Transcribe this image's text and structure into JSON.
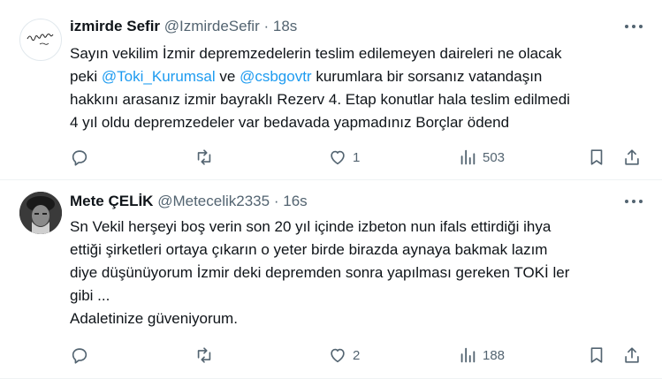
{
  "tweets": [
    {
      "name": "izmirde Sefir",
      "handle": "@IzmirdeSefir",
      "dot": "·",
      "time": "18s",
      "avatar_icon": "script-logo-avatar",
      "lines": [
        [
          {
            "t": "Sayın vekilim İzmir depremzedelerin teslim edilemeyen daireleri ne olacak"
          }
        ],
        [
          {
            "t": "peki "
          },
          {
            "t": "@Toki_Kurumsal",
            "m": true
          },
          {
            "t": " ve "
          },
          {
            "t": "@csbgovtr",
            "m": true
          },
          {
            "t": " kurumlara bir sorsanız vatandaşın"
          }
        ],
        [
          {
            "t": "hakkını arasanız izmir bayraklı Rezerv 4. Etap konutlar hala teslim edilmedi"
          }
        ],
        [
          {
            "t": "4 yıl oldu depremzedeler var bedavada yapmadınız Borçlar ödend"
          }
        ]
      ],
      "stats": {
        "reply": "",
        "retweet": "",
        "like": "1",
        "views": "503"
      }
    },
    {
      "name": "Mete ÇELİK",
      "handle": "@Metecelik2335",
      "dot": "·",
      "time": "16s",
      "avatar_icon": "photo-avatar",
      "lines": [
        [
          {
            "t": "Sn Vekil herşeyi boş verin son 20  yıl içinde izbeton nun ifals ettirdiği ihya"
          }
        ],
        [
          {
            "t": "ettiği şirketleri ortaya çıkarın  o yeter birde birazda aynaya bakmak lazım"
          }
        ],
        [
          {
            "t": "diye düşünüyorum İzmir deki depremden sonra yapılması gereken TOKİ ler"
          }
        ],
        [
          {
            "t": "gibi ..."
          }
        ],
        [
          {
            "t": "Adaletinize güveniyorum."
          }
        ]
      ],
      "stats": {
        "reply": "",
        "retweet": "",
        "like": "2",
        "views": "188"
      }
    }
  ],
  "icons": {
    "more": "more-dots-icon",
    "reply": "reply-icon",
    "retweet": "retweet-icon",
    "like": "heart-icon",
    "views": "views-chart-icon",
    "bookmark": "bookmark-icon",
    "share": "share-icon"
  },
  "colors": {
    "text": "#0f1419",
    "secondary": "#536471",
    "link": "#1d9bf0",
    "border": "#eff3f4"
  }
}
